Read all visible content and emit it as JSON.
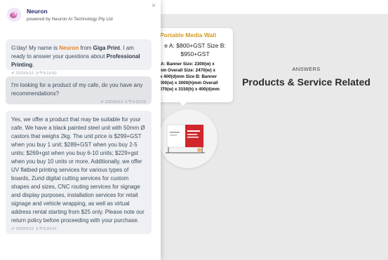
{
  "background": {
    "product": {
      "title": "Portable Media Wall",
      "price_line1": "e A: $800+GST Size B:",
      "price_line2": "$950+GST",
      "desc_lines": [
        "e A: Banner Size: 2300(w) x",
        ")mm Overall Size: 2470(w) x",
        ") x 400(d)mm Size B: Banner",
        "3000(w) x 3000(h)mm Overall",
        "3070(w) x 3150(h) x 400(d)mm"
      ]
    },
    "answers_label": "ANSWERS",
    "answers_heading": "Products & Service Related"
  },
  "chat": {
    "bot_name": "Neuron",
    "bot_subtitle": "powered by Neuron AI Technology Pty Ltd",
    "close_glyph": "×",
    "messages": [
      {
        "role": "bot",
        "text_pre": "G'day! My name is ",
        "name": "Neuron",
        "text_mid": " from ",
        "company": "Giga Print",
        "text_mid2": ". I am ready to answer your questions about ",
        "topic": "Professional Printing",
        "text_end": ".",
        "time": "2023/5/12 上午9:19:52"
      },
      {
        "role": "user",
        "text": "I'm looking for a product of my cafe, do you have any recommendations?",
        "time": "2023/5/12 上午9:20:29"
      },
      {
        "role": "bot",
        "text": "Yes, we offer a product that may be suitable for your cafe. We have a black painted steel unit with 50mm Ø castors that weighs 2kg. The unit price is $299+GST when you buy 1 unit; $289+GST when you buy 2-5 units; $269+gst when you buy 6-10 units; $229+gst when you buy 10 units or more. Additionally, we offer UV flatbed printing services for various types of boards, Zund digital cutting services for custom shapes and sizes, CNC routing services for signage and display purposes, installation services for retail signage and vehicle wrapping, as well as virtual address rental starting from $25 only. Please note our return policy before proceeding with your purchase.",
        "time": "2023/5/12 上午9:20:41"
      }
    ]
  },
  "colors": {
    "accent_orange": "#e6812a",
    "bot_name": "#2a2a6e",
    "product_title": "#d29a22",
    "banner_red": "#d0262c"
  },
  "icons": [
    "close-icon",
    "check-icon",
    "avatar-icon"
  ]
}
